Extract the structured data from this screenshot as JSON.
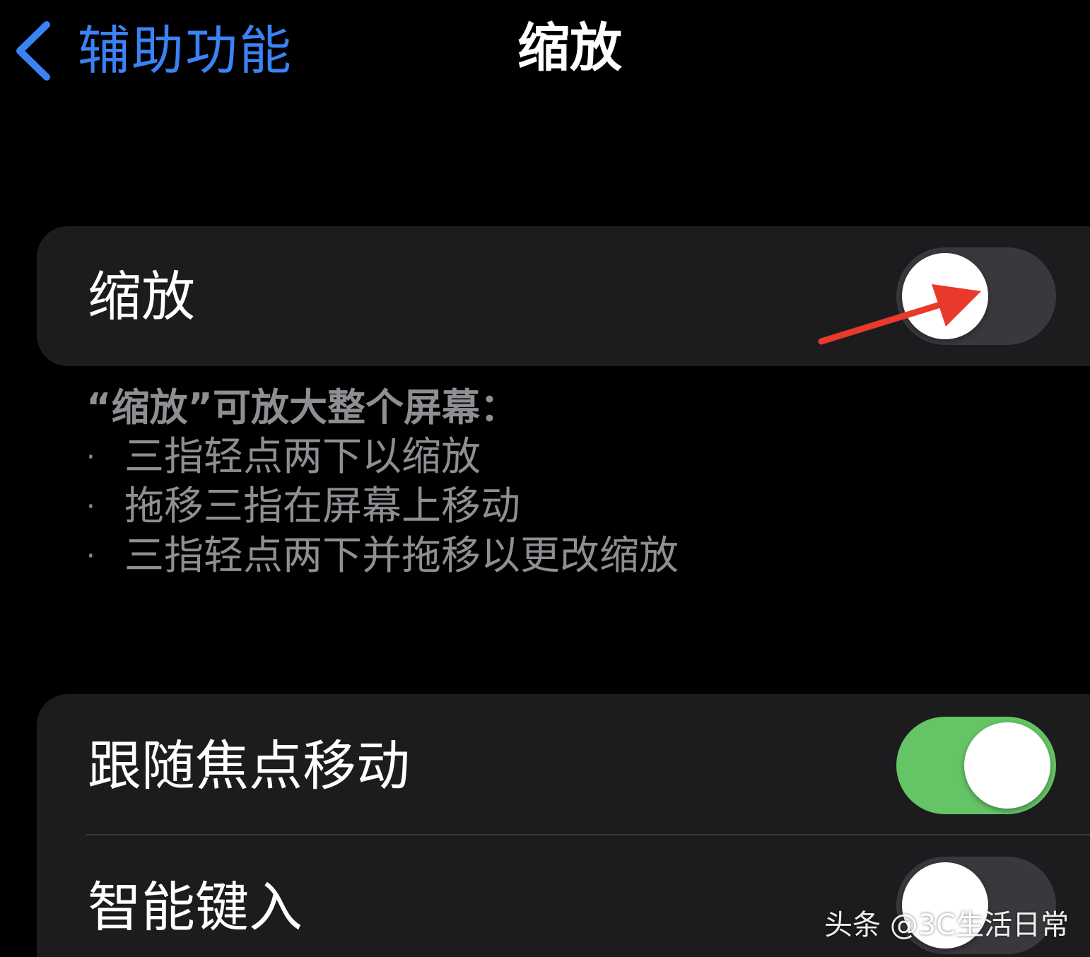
{
  "nav": {
    "back_label": "辅助功能",
    "title": "缩放",
    "accent_color": "#3b82f6"
  },
  "zoom_group": {
    "label": "缩放",
    "toggle": "off"
  },
  "description": {
    "heading": "“缩放”可放大整个屏幕：",
    "bullet": "·",
    "items": [
      "三指轻点两下以缩放",
      "拖移三指在屏幕上移动",
      "三指轻点两下并拖移以更改缩放"
    ]
  },
  "options_group": {
    "rows": [
      {
        "label": "跟随焦点移动",
        "toggle": "on"
      },
      {
        "label": "智能键入",
        "toggle": "off"
      }
    ]
  },
  "colors": {
    "toggle_on": "#65c466",
    "toggle_off": "#39393d",
    "annotation": "#e8392b"
  },
  "watermark": "头条 @3C生活日常"
}
